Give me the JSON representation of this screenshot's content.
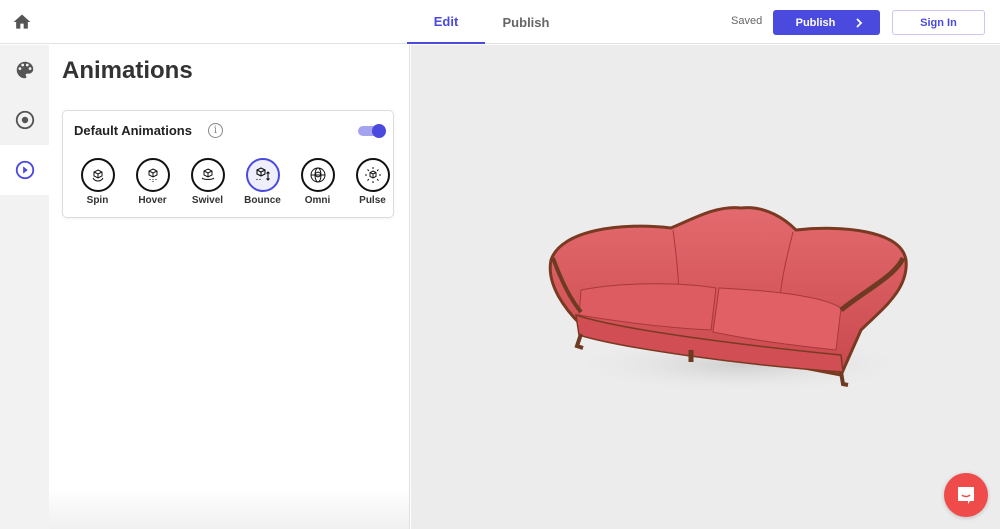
{
  "topbar": {
    "home_icon": "home-icon",
    "tabs": [
      {
        "label": "Edit",
        "active": true
      },
      {
        "label": "Publish",
        "active": false
      }
    ],
    "status": "Saved",
    "publish_label": "Publish",
    "signin_label": "Sign In"
  },
  "rail": {
    "items": [
      {
        "icon": "palette-icon",
        "active": false
      },
      {
        "icon": "target-icon",
        "active": false
      },
      {
        "icon": "play-icon",
        "active": true
      }
    ]
  },
  "panel": {
    "title": "Animations",
    "card": {
      "title": "Default Animations",
      "info_icon": "i",
      "toggle_on": true,
      "animations": [
        {
          "label": "Spin",
          "icon": "spin-icon",
          "active": false
        },
        {
          "label": "Hover",
          "icon": "hover-icon",
          "active": false
        },
        {
          "label": "Swivel",
          "icon": "swivel-icon",
          "active": false
        },
        {
          "label": "Bounce",
          "icon": "bounce-icon",
          "active": true
        },
        {
          "label": "Omni",
          "icon": "omni-icon",
          "active": false
        },
        {
          "label": "Pulse",
          "icon": "pulse-icon",
          "active": false
        }
      ]
    }
  },
  "viewer": {
    "model": "red leather sofa"
  },
  "colors": {
    "accent": "#4a4adf",
    "chat": "#ef4b4b",
    "sofa": "#d9555a"
  }
}
